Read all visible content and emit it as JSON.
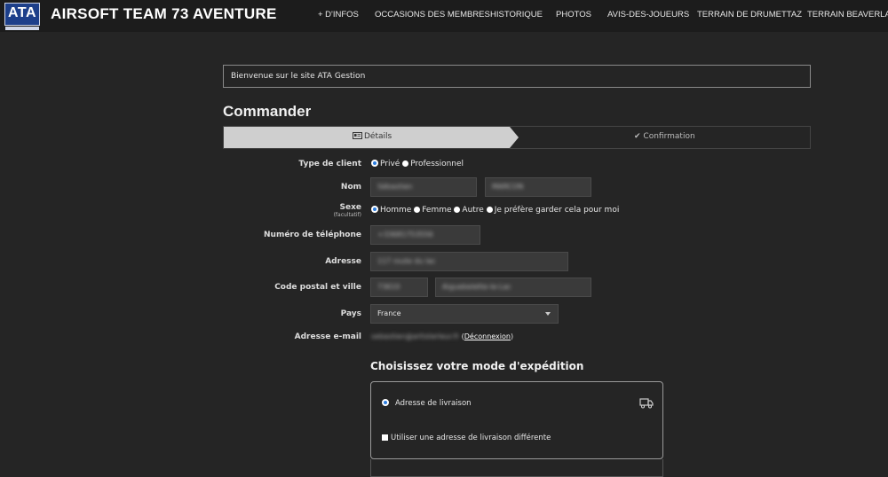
{
  "header": {
    "logo_text": "ATA",
    "site_title": "AIRSOFT TEAM 73 AVENTURE",
    "nav": [
      "+ D'INFOS",
      "OCCASIONS DES MEMBRES",
      "HISTORIQUE",
      "PHOTOS",
      "AVIS-DES-JOUEURS",
      "TERRAIN DE DRUMETTAZ",
      "TERRAIN BEAVERLAND"
    ]
  },
  "welcome": "Bienvenue sur le site ATA Gestion",
  "page_title": "Commander",
  "steps": {
    "details": "Détails",
    "confirmation": "Confirmation"
  },
  "form": {
    "client_type": {
      "label": "Type de client",
      "options": [
        "Privé",
        "Professionnel"
      ],
      "selected": "Privé"
    },
    "name": {
      "label": "Nom",
      "first": "Sébastien",
      "last": "MARCON"
    },
    "gender": {
      "label": "Sexe",
      "hint": "(facultatif)",
      "options": [
        "Homme",
        "Femme",
        "Autre",
        "Je préfère garder cela pour moi"
      ],
      "selected": "Homme"
    },
    "phone": {
      "label": "Numéro de téléphone",
      "value": "+33681753556"
    },
    "address": {
      "label": "Adresse",
      "value": "117 route du lac"
    },
    "postal_city": {
      "label": "Code postal et ville",
      "postal": "73610",
      "city": "Aiguebelette-le-Lac"
    },
    "country": {
      "label": "Pays",
      "value": "France"
    },
    "email": {
      "label": "Adresse e-mail",
      "value": "sebastien@artisterleur.fr",
      "logout_label": "Déconnexion"
    }
  },
  "shipping": {
    "title": "Choisissez votre mode d'expédition",
    "option_label": "Adresse de livraison",
    "different_address_label": "Utiliser une adresse de livraison différente"
  },
  "colors": {
    "background": "#252525",
    "accent_radio": "#2b7de0",
    "step_active": "#cfcfcf"
  }
}
